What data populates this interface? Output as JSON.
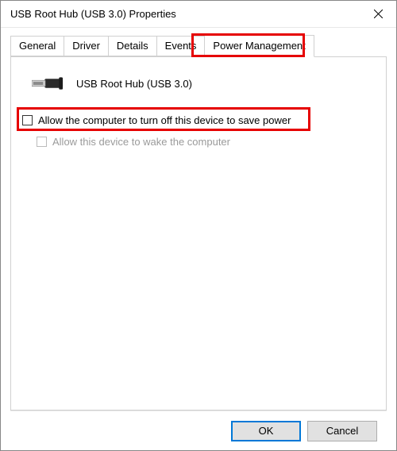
{
  "window": {
    "title": "USB Root Hub (USB 3.0) Properties"
  },
  "tabs": {
    "general": "General",
    "driver": "Driver",
    "details": "Details",
    "events": "Events",
    "power": "Power Management"
  },
  "panel": {
    "device_name": "USB Root Hub (USB 3.0)",
    "option_turnoff": "Allow the computer to turn off this device to save power",
    "option_wake": "Allow this device to wake the computer"
  },
  "buttons": {
    "ok": "OK",
    "cancel": "Cancel"
  }
}
